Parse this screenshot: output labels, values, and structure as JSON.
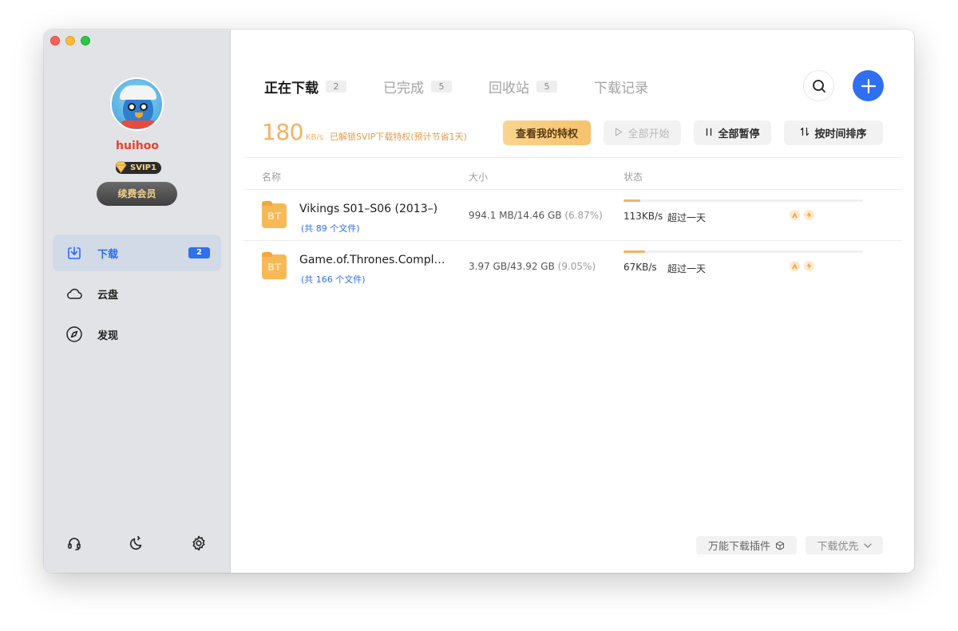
{
  "colors": {
    "accent": "#2f6ff0",
    "speed": "#f5b063",
    "sidebar_bg": "#e2e3e6",
    "username": "#e8402b"
  },
  "sidebar": {
    "username": "huihoo",
    "svip_label": "SVIP1",
    "renew_label": "续费会员",
    "nav": [
      {
        "label": "下载",
        "icon": "download-tray-icon",
        "badge": "2",
        "active": true
      },
      {
        "label": "云盘",
        "icon": "cloud-icon"
      },
      {
        "label": "发现",
        "icon": "compass-icon"
      }
    ],
    "bottom_icons": [
      "headset-icon",
      "moon-icon",
      "gear-icon"
    ]
  },
  "tabs": [
    {
      "label": "正在下载",
      "count": "2",
      "active": true
    },
    {
      "label": "已完成",
      "count": "5"
    },
    {
      "label": "回收站",
      "count": "5"
    },
    {
      "label": "下载记录"
    }
  ],
  "speed": {
    "value": "180",
    "unit": "KB/s",
    "note": "已解锁SVIP下载特权(预计节省1天)"
  },
  "actions": {
    "privilege": "查看我的特权",
    "start_all": "全部开始",
    "pause_all": "全部暂停",
    "sort": "按时间排序"
  },
  "columns": {
    "name": "名称",
    "size": "大小",
    "status": "状态"
  },
  "downloads": [
    {
      "name": "Vikings S01–S06 (2013–)",
      "files": "(共 89 个文件)",
      "size": "994.1 MB/14.46 GB",
      "percent_text": "(6.87%)",
      "progress": 0.0687,
      "speed": "113KB/s",
      "eta": "超过一天",
      "icon_label": "BT"
    },
    {
      "name": "Game.of.Thrones.Complete.Series",
      "files": "(共 166 个文件)",
      "size": "3.97 GB/43.92 GB",
      "percent_text": "(9.05%)",
      "progress": 0.0905,
      "speed": "67KB/s",
      "eta": "超过一天",
      "icon_label": "BT"
    }
  ],
  "footer": {
    "plugin": "万能下载插件",
    "priority": "下载优先"
  }
}
